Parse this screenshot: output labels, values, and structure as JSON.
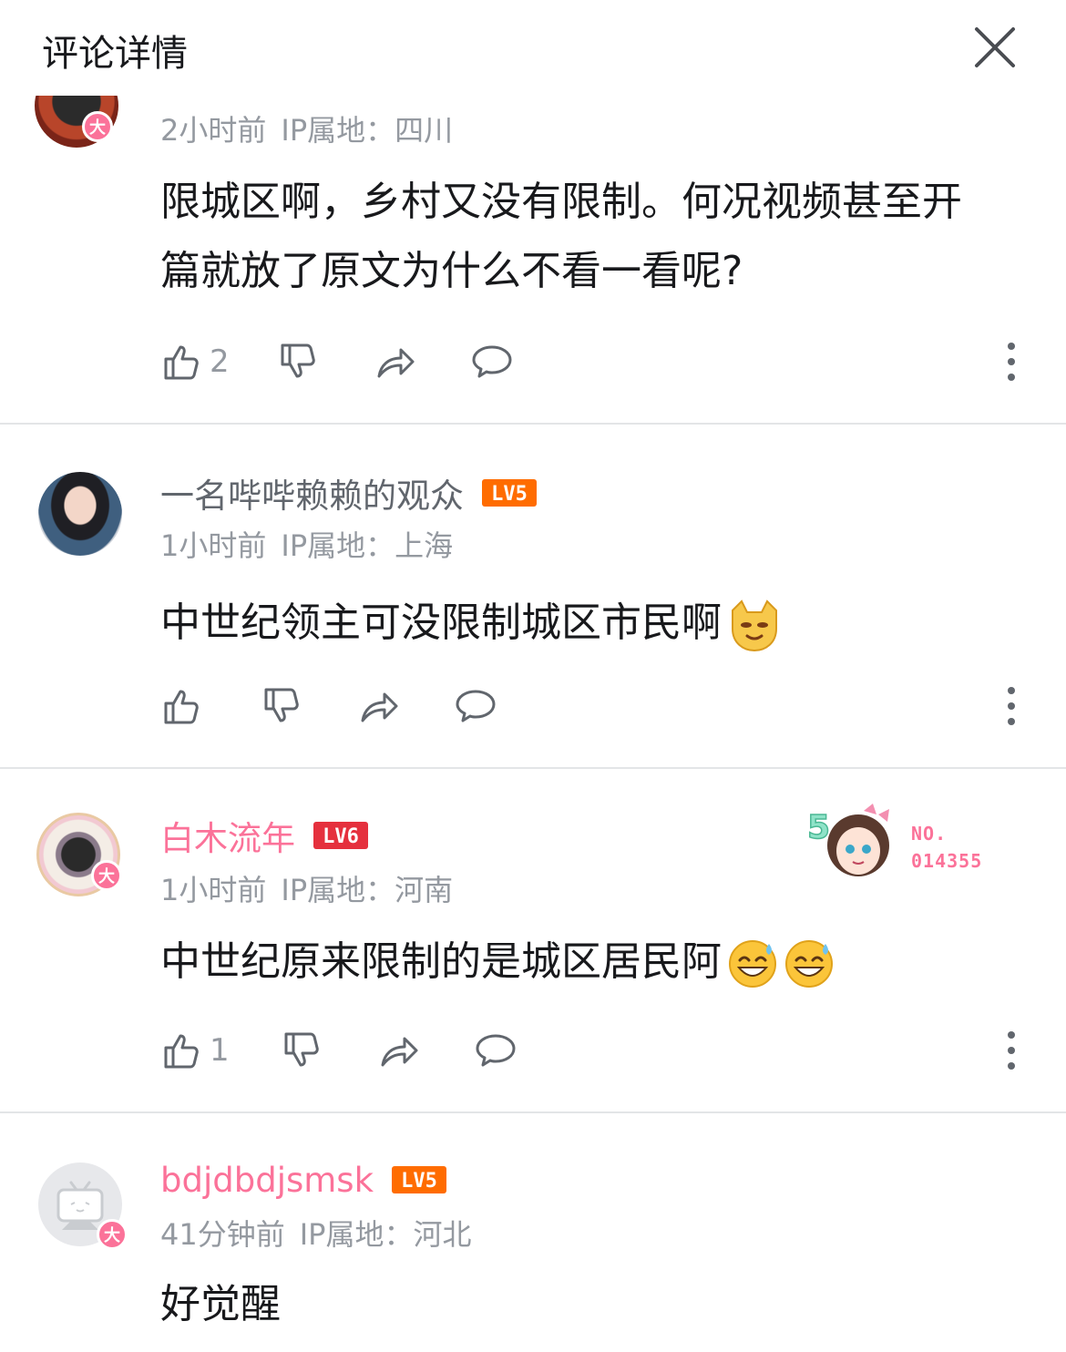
{
  "header": {
    "title": "评论详情",
    "close_icon": "close-icon"
  },
  "colors": {
    "vip_pink": "#fb7299",
    "level_orange": "#ff6c00",
    "level_red": "#e5303d",
    "meta_gray": "#9499a0"
  },
  "comments": [
    {
      "username": "",
      "time": "2小时前",
      "ip": "IP属地：四川",
      "text": "限城区啊，乡村又没有限制。何况视频甚至开篇就放了原文为什么不看一看呢?",
      "likes": "2"
    },
    {
      "username": "一名哔哔赖赖的观众",
      "level": "LV5",
      "time": "1小时前",
      "ip": "IP属地：上海",
      "text": "中世纪领主可没限制城区市民啊",
      "likes": ""
    },
    {
      "username": "白木流年",
      "level": "LV6",
      "time": "1小时前",
      "ip": "IP属地：河南",
      "text": "中世纪原来限制的是城区居民阿",
      "likes": "1",
      "medal": {
        "number_label": "NO.",
        "number": "014355",
        "figure": "5"
      }
    },
    {
      "username": "bdjdbdjsmsk",
      "level": "LV5",
      "time": "41分钟前",
      "ip": "IP属地：河北",
      "text": "好觉醒"
    }
  ]
}
